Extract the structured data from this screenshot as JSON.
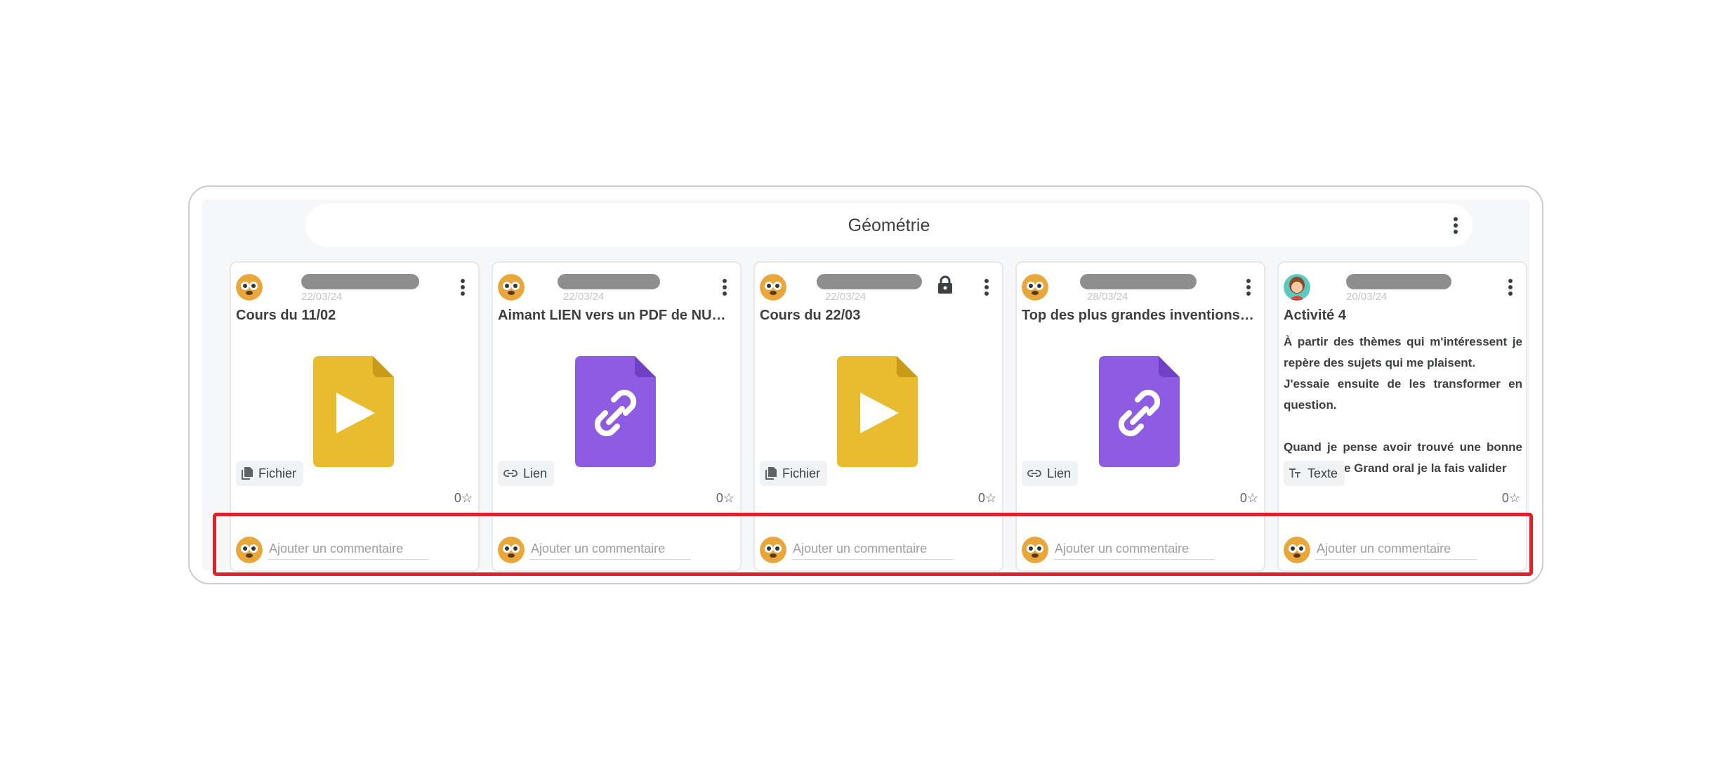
{
  "board": {
    "section_title": "Géométrie",
    "cards": [
      {
        "date": "22/03/24",
        "title": "Cours du 11/02",
        "type_label": "Fichier",
        "type_icon": "file-icon",
        "media_icon": "play-icon",
        "locked": false,
        "rating": "0☆",
        "comment_placeholder": "Ajouter un commentaire"
      },
      {
        "date": "22/03/24",
        "title": "Aimant LIEN vers un PDF de NUAG...",
        "type_label": "Lien",
        "type_icon": "link-icon",
        "media_icon": "link-icon",
        "locked": false,
        "rating": "0☆",
        "comment_placeholder": "Ajouter un commentaire"
      },
      {
        "date": "22/03/24",
        "title": "Cours du 22/03",
        "type_label": "Fichier",
        "type_icon": "file-icon",
        "media_icon": "play-icon",
        "locked": true,
        "rating": "0☆",
        "comment_placeholder": "Ajouter un commentaire"
      },
      {
        "date": "28/03/24",
        "title": "Top des plus grandes inventions d...",
        "type_label": "Lien",
        "type_icon": "link-icon",
        "media_icon": "link-icon",
        "locked": false,
        "rating": "0☆",
        "comment_placeholder": "Ajouter un commentaire"
      },
      {
        "date": "20/03/24",
        "title": "Activité 4",
        "type_label": "Texte",
        "type_icon": "text-format-icon",
        "locked": false,
        "body": {
          "p1": "À partir des thèmes qui m'intéressent je repère des sujets qui me plaisent.",
          "p2": "J'essaie ensuite de les transformer en question.",
          "p3": "Quand je pense avoir trouvé une bonne question de Grand oral je la fais valider"
        },
        "rating": "0☆",
        "comment_placeholder": "Ajouter un commentaire"
      }
    ]
  },
  "colors": {
    "file_yellow": "#e9bb2e",
    "link_purple": "#8e5be3",
    "highlight_red": "#e0202a"
  }
}
